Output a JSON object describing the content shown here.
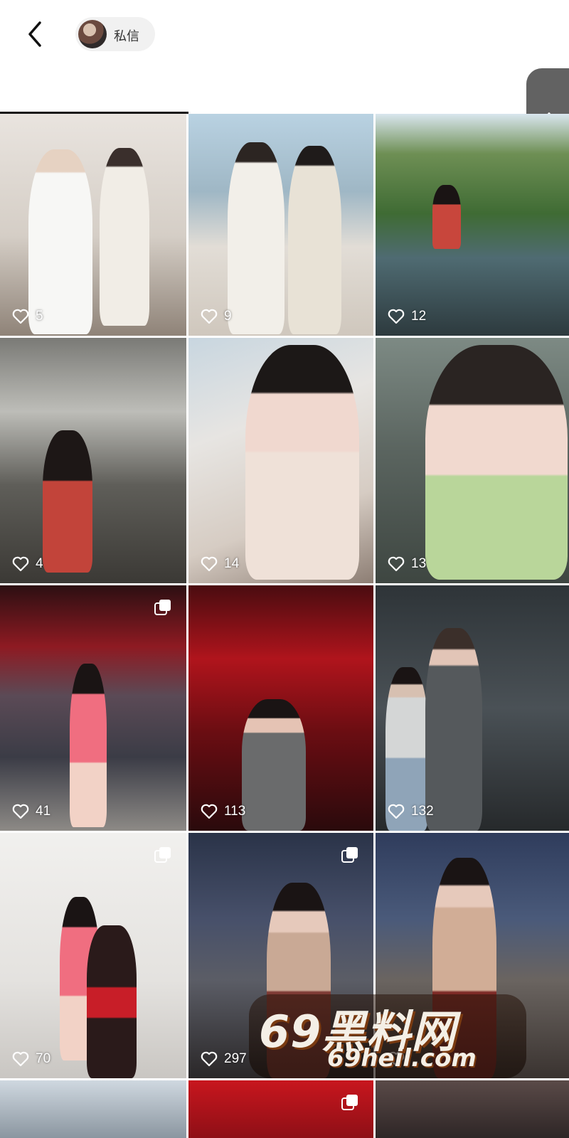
{
  "header": {
    "dm_label": "私信"
  },
  "posts": [
    {
      "likes": "5",
      "multi": false
    },
    {
      "likes": "9",
      "multi": false
    },
    {
      "likes": "12",
      "multi": false
    },
    {
      "likes": "4",
      "multi": false
    },
    {
      "likes": "14",
      "multi": false
    },
    {
      "likes": "13",
      "multi": false
    },
    {
      "likes": "41",
      "multi": true
    },
    {
      "likes": "113",
      "multi": false
    },
    {
      "likes": "132",
      "multi": false
    },
    {
      "likes": "70",
      "multi": true
    },
    {
      "likes": "297",
      "multi": true
    },
    {
      "likes": "",
      "multi": false
    }
  ],
  "watermark": {
    "line1": "69黑料网",
    "line2": "69heil.com"
  },
  "colors": {
    "like_text": "#ffffff",
    "topbar_bg": "#ffffff"
  }
}
